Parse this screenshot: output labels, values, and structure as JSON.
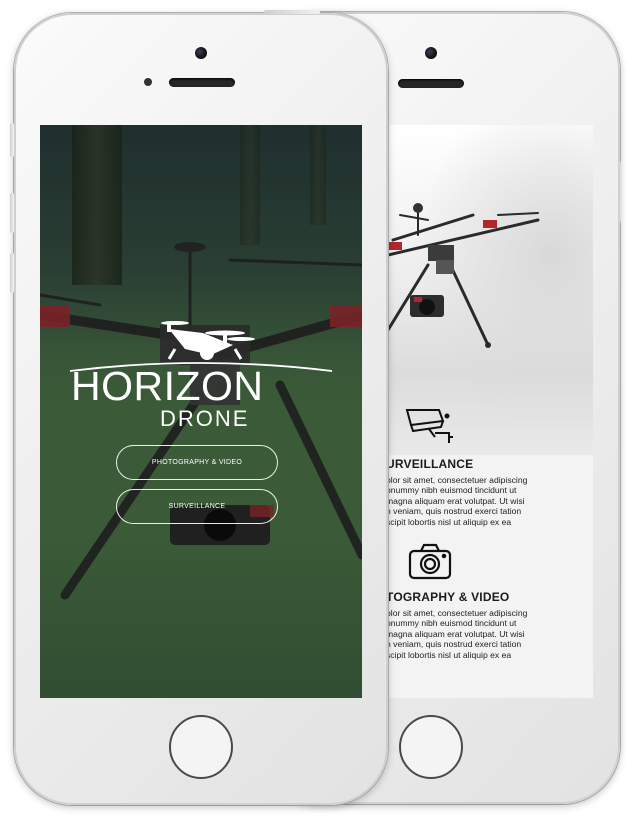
{
  "front_screen": {
    "brand": {
      "title": "HORIZON",
      "subtitle": "DRONE"
    },
    "buttons": [
      {
        "label": "PHOTOGRAPHY & VIDEO"
      },
      {
        "label": "SURVEILLANCE"
      }
    ]
  },
  "back_screen": {
    "sections": [
      {
        "icon": "cctv-camera-icon",
        "title": "URVEILLANCE",
        "body": "olor sit amet, consectetuer adipiscing\nonummy nibh euismod tincidunt ut\nmagna aliquam erat volutpat. Ut wisi\nn veniam, quis nostrud exerci tation\nscipit lobortis nisl ut aliquip ex ea"
      },
      {
        "icon": "photo-camera-icon",
        "title": "TOGRAPHY & VIDEO",
        "body": "olor sit amet, consectetuer adipiscing\nonummy nibh euismod tincidunt ut\nmagna aliquam erat volutpat. Ut wisi\nn veniam, quis nostrud exerci tation\nscipit lobortis nisl ut aliquip ex ea"
      }
    ]
  },
  "colors": {
    "phone_body": "#f0f0f0",
    "text_dark": "#1b1b1b",
    "drone_red": "#b3262b",
    "button_border": "#ffffff"
  }
}
